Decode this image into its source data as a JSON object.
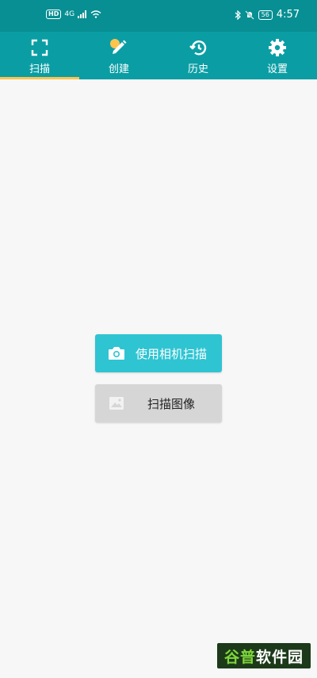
{
  "status_bar": {
    "left_badge": "HD",
    "signal_label": "4G",
    "time": "4:57",
    "battery": "56"
  },
  "tabs": [
    {
      "label": "扫描",
      "icon": "scan-frame-icon",
      "active": true
    },
    {
      "label": "创建",
      "icon": "pencil-icon",
      "active": false
    },
    {
      "label": "历史",
      "icon": "history-icon",
      "active": false
    },
    {
      "label": "设置",
      "icon": "gear-icon",
      "active": false
    }
  ],
  "main": {
    "camera_scan_label": "使用相机扫描",
    "image_scan_label": "扫描图像"
  },
  "watermark": {
    "part1": "谷普",
    "part2": "软件园"
  },
  "colors": {
    "status_bar": "#078f93",
    "tab_bar": "#0a9ea4",
    "active_indicator": "#ffc44d",
    "camera_button": "#2fc4d2",
    "image_button": "#d6d6d6",
    "background": "#f7f7f7"
  }
}
